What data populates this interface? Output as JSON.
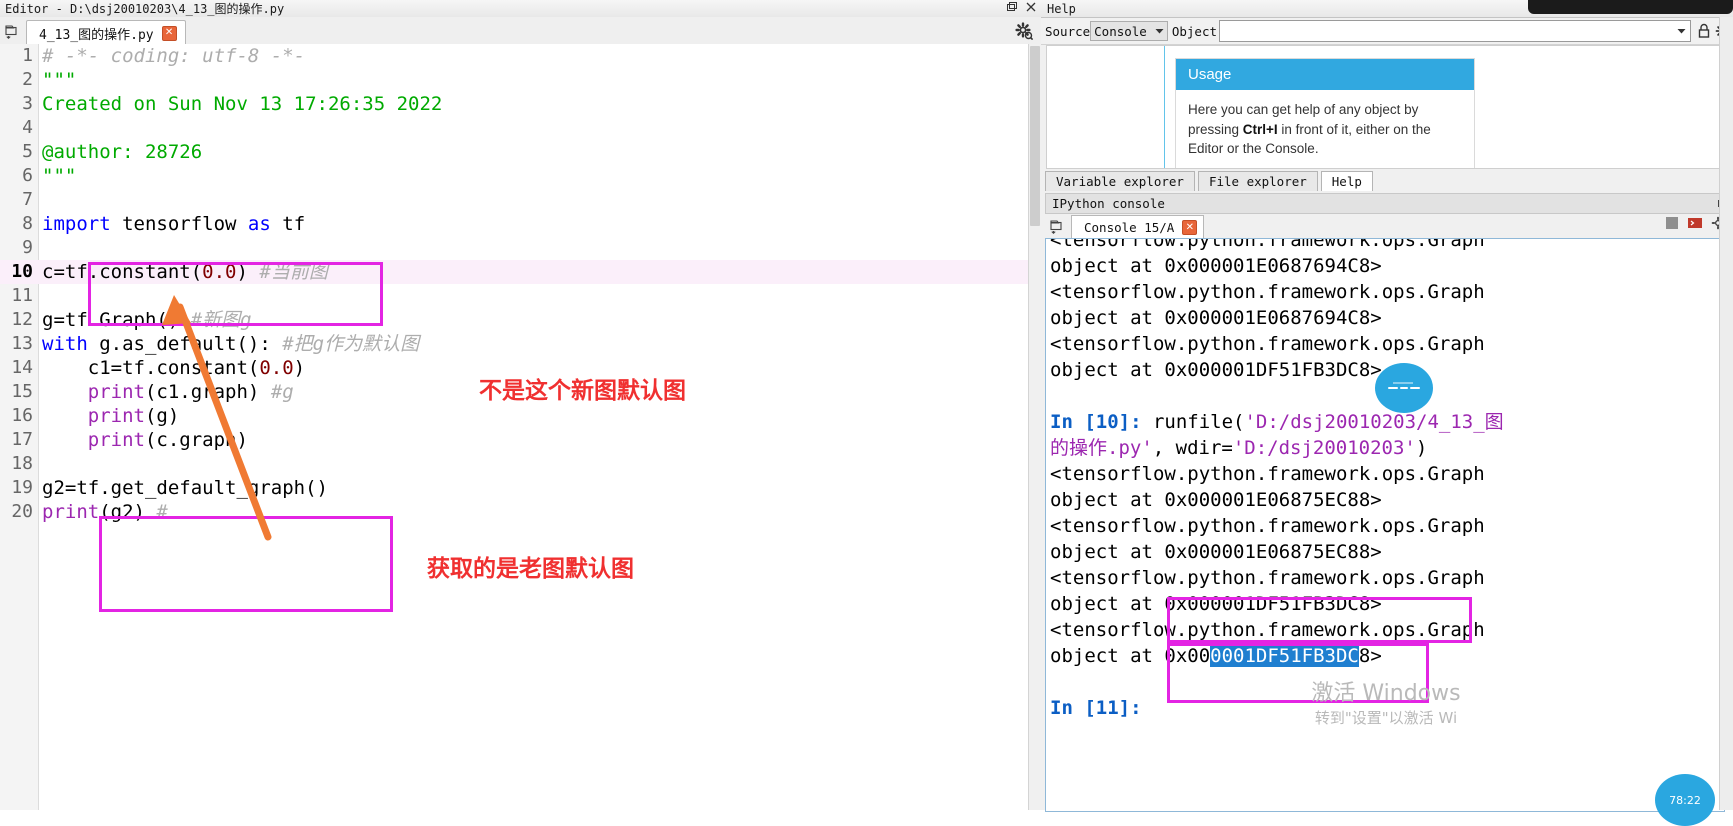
{
  "editor": {
    "window_title": "Editor - D:\\dsj20010203\\4_13_图的操作.py",
    "tab_label": "4_13_图的操作.py",
    "tab_close_glyph": "✕",
    "lines": [
      {
        "n": "1",
        "html": "<span class='tok-cmt'># -*- coding: utf-8 -*-</span>"
      },
      {
        "n": "2",
        "html": "<span class='tok-str'>\"\"\"</span>"
      },
      {
        "n": "3",
        "html": "<span class='tok-str'>Created on Sun Nov 13 17:26:35 2022</span>"
      },
      {
        "n": "4",
        "html": ""
      },
      {
        "n": "5",
        "html": "<span class='tok-str'>@author: 28726</span>"
      },
      {
        "n": "6",
        "html": "<span class='tok-str'>\"\"\"</span>"
      },
      {
        "n": "7",
        "html": ""
      },
      {
        "n": "8",
        "html": "<span class='tok-kw'>import</span> tensorflow <span class='tok-kw'>as</span> tf"
      },
      {
        "n": "9",
        "html": ""
      },
      {
        "n": "10",
        "html": "c=tf.constant(<span class='tok-num'>0.0</span>) <span class='tok-cmt'>#当前图</span>",
        "current": true
      },
      {
        "n": "11",
        "html": ""
      },
      {
        "n": "12",
        "html": "g=tf.Graph() <span class='tok-cmt'>#新图g</span>"
      },
      {
        "n": "13",
        "html": "<span class='tok-kw'>with</span> g.as_default(): <span class='tok-cmt'>#把g作为默认图</span>"
      },
      {
        "n": "14",
        "html": "    c1=tf.constant(<span class='tok-num'>0.0</span>)"
      },
      {
        "n": "15",
        "html": "    <span class='tok-builtin'>print</span>(c1.graph) <span class='tok-cmt'>#g</span>"
      },
      {
        "n": "16",
        "html": "    <span class='tok-builtin'>print</span>(g)"
      },
      {
        "n": "17",
        "html": "    <span class='tok-builtin'>print</span>(c.graph)"
      },
      {
        "n": "18",
        "html": ""
      },
      {
        "n": "19",
        "html": "g2=tf.get_default_graph()"
      },
      {
        "n": "20",
        "html": "<span class='tok-builtin'>print</span>(g2) <span class='tok-cmt'>#</span>"
      }
    ],
    "annotations": {
      "note_line13": "不是这个新图默认图",
      "note_line19": "获取的是老图默认图",
      "box_color": "#e324e3",
      "note_color": "#f03030",
      "arrow_color": "#f07a33"
    }
  },
  "help": {
    "window_title": "Help",
    "source_label": "Source",
    "source_value": "Console",
    "object_label": "Object",
    "object_value": "",
    "usage_title": "Usage",
    "usage_body_1": "Here you can get help of any object by",
    "usage_body_2a": "pressing ",
    "usage_body_2b": "Ctrl+I",
    "usage_body_2c": " in front of it, either on the",
    "usage_body_3": "Editor or the Console.",
    "accent": "#31a8e0"
  },
  "tabs": {
    "items": [
      {
        "label": "Variable explorer",
        "active": false
      },
      {
        "label": "File explorer",
        "active": false
      },
      {
        "label": "Help",
        "active": true
      }
    ]
  },
  "console": {
    "panel_title": "IPython console",
    "tab_label": "Console 15/A",
    "tab_close_glyph": "✕",
    "lines": [
      {
        "html": "&lt;tensorflow.python.framework.ops.Graph",
        "clip": true
      },
      {
        "html": "object at 0x000001E0687694C8&gt;"
      },
      {
        "html": "&lt;tensorflow.python.framework.ops.Graph"
      },
      {
        "html": "object at 0x000001E0687694C8&gt;"
      },
      {
        "html": "&lt;tensorflow.python.framework.ops.Graph"
      },
      {
        "html": "object at 0x000001DF51FB3DC8&gt;"
      },
      {
        "html": ""
      },
      {
        "html": "<span class='cons-in'>In [10]:</span> runfile(<span class='cons-str'>'D:/dsj20010203/4_13_图</span>"
      },
      {
        "html": "<span class='cons-str'>的操作.py'</span>, wdir=<span class='cons-str'>'D:/dsj20010203'</span>)"
      },
      {
        "html": "&lt;tensorflow.python.framework.ops.Graph"
      },
      {
        "html": "object at 0x000001E06875EC88&gt;"
      },
      {
        "html": "&lt;tensorflow.python.framework.ops.Graph"
      },
      {
        "html": "object at 0x000001E06875EC88&gt;"
      },
      {
        "html": "&lt;tensorflow.python.framework.ops.Graph"
      },
      {
        "html": "object at 0x000001DF51FB3DC8&gt;"
      },
      {
        "html": "&lt;tensorflow.python.framework.ops.Graph"
      },
      {
        "html": "object at 0x00<span class='sel'>0001DF51FB3DC</span>8&gt;"
      },
      {
        "html": ""
      },
      {
        "html": "<span class='cons-in'>In [11]:</span>"
      }
    ]
  },
  "watermark": {
    "line1": "激活 Windows",
    "line2": "转到\"设置\"以激活 Wi"
  },
  "badges": {
    "top_right": "78:22"
  }
}
